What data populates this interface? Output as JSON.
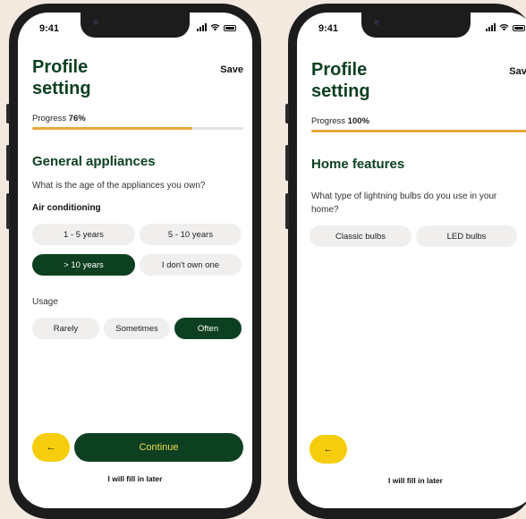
{
  "status_bar": {
    "time": "9:41"
  },
  "left_screen": {
    "title": "Profile setting",
    "save_label": "Save",
    "progress_label": "Progress",
    "progress_value": "76%",
    "progress_fraction": 0.76,
    "section_title": "General appliances",
    "question": "What is the age of the appliances you own?",
    "subheading": "Air conditioning",
    "age_options": [
      "1 - 5 years",
      "5 - 10 years",
      "> 10 years",
      "I don't own one"
    ],
    "age_selected": "> 10 years",
    "usage_label": "Usage",
    "usage_options": [
      "Rarely",
      "Sometimes",
      "Often"
    ],
    "usage_selected": "Often",
    "back_label": "←",
    "continue_label": "Continue",
    "later_label": "I will fill in later"
  },
  "right_screen": {
    "title": "Profile setting",
    "save_label": "Save",
    "progress_label": "Progress",
    "progress_value": "100%",
    "progress_fraction": 1.0,
    "section_title": "Home features",
    "question": "What type of lightning bulbs do you use in your home?",
    "bulb_options": [
      "Classic bulbs",
      "LED bulbs"
    ],
    "back_label": "←",
    "later_label": "I will fill in later"
  },
  "colors": {
    "background": "#f3e9df",
    "brand_green": "#0d4020",
    "progress_orange": "#e9a63a",
    "back_button_yellow": "#f5cd0a",
    "chip_gray": "#f0efee"
  },
  "icons": [
    "signal-icon",
    "wifi-icon",
    "battery-icon",
    "arrow-left-icon"
  ]
}
